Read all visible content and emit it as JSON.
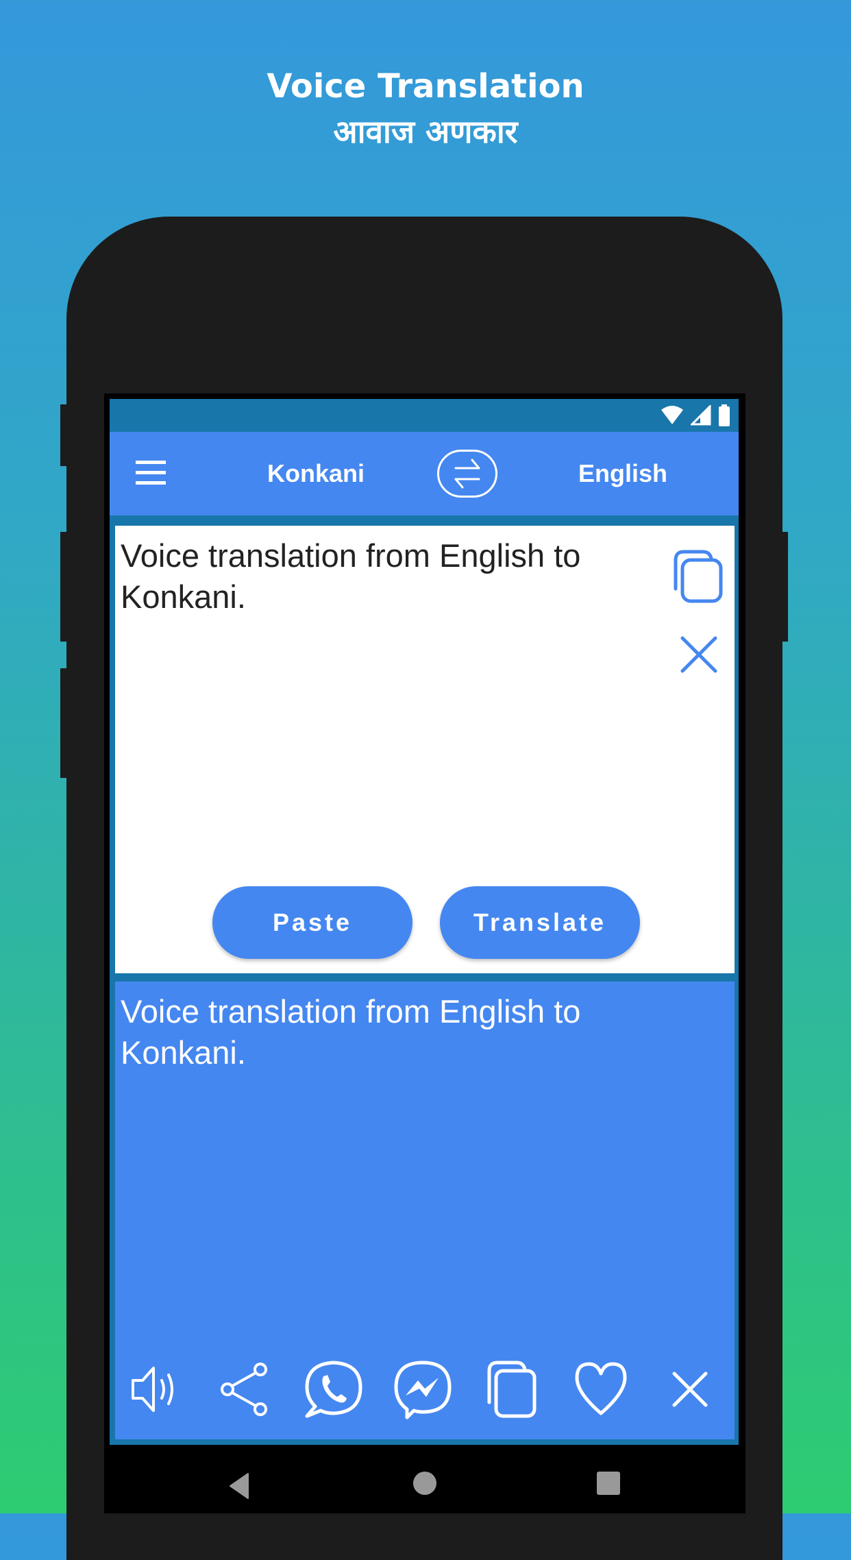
{
  "promo": {
    "title": "Voice Translation",
    "subtitle": "आवाज अणकार"
  },
  "status_bar": {
    "icons": [
      "wifi-icon",
      "cellular-signal-icon",
      "battery-icon"
    ]
  },
  "app_bar": {
    "menu_icon": "hamburger-menu-icon",
    "source_language": "Konkani",
    "swap_icon": "swap-languages-icon",
    "target_language": "English"
  },
  "input": {
    "text": "Voice translation from English to Konkani.",
    "copy_icon": "copy-icon",
    "clear_icon": "close-icon",
    "paste_label": "Paste",
    "translate_label": "Translate"
  },
  "output": {
    "text": "Voice translation from English to Konkani.",
    "actions": [
      {
        "name": "speak",
        "icon": "speaker-icon"
      },
      {
        "name": "share",
        "icon": "share-icon"
      },
      {
        "name": "whatsapp",
        "icon": "whatsapp-icon"
      },
      {
        "name": "messenger",
        "icon": "messenger-icon"
      },
      {
        "name": "copy",
        "icon": "copy-icon"
      },
      {
        "name": "favorite",
        "icon": "heart-icon"
      },
      {
        "name": "clear",
        "icon": "close-icon"
      }
    ]
  },
  "nav_bar": {
    "buttons": [
      "back-icon",
      "home-icon",
      "recents-icon"
    ]
  },
  "colors": {
    "primary": "#4587f0",
    "primary_dark": "#1976aa",
    "phone_body": "#1c1c1c",
    "gradient_top": "#3498db",
    "gradient_bottom": "#2ecc71"
  }
}
